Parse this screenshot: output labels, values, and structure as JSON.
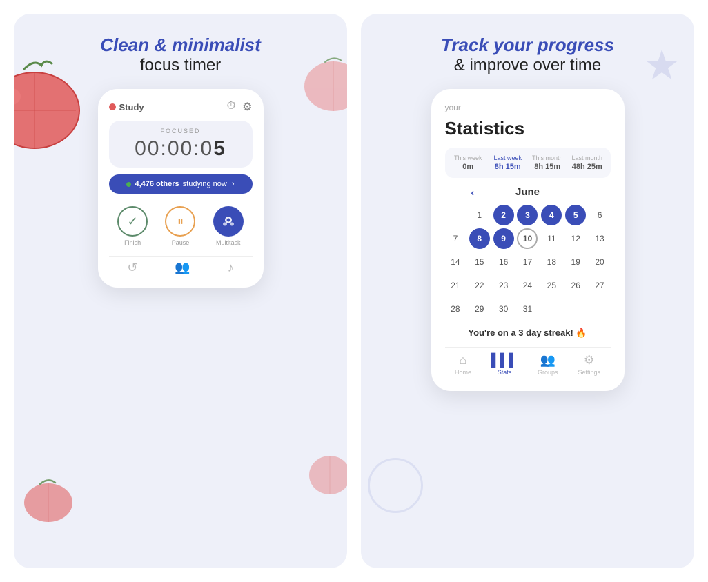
{
  "left": {
    "headline_italic": "Clean & minimalist",
    "headline_normal": "focus timer",
    "phone": {
      "study_label": "Study",
      "focused_label": "FOCUSED",
      "timer": "00:00:0",
      "timer_last": "5",
      "studying_text": "4,476 others studying now",
      "studying_arrow": ">",
      "actions": [
        {
          "label": "Finish",
          "icon": "✓",
          "type": "finish"
        },
        {
          "label": "Pause",
          "icon": "⏸",
          "type": "pause"
        },
        {
          "label": "Multitask",
          "icon": "👾",
          "type": "multitask"
        }
      ]
    }
  },
  "right": {
    "headline_italic": "Track your progress",
    "headline_normal": "& improve over time",
    "phone": {
      "stats_small": "your",
      "stats_title": "Statistics",
      "stats_cells": [
        {
          "header": "This week",
          "value": "0m",
          "active": false
        },
        {
          "header": "Last week",
          "value": "8h 15m",
          "active": true
        },
        {
          "header": "This month",
          "value": "8h 15m",
          "active": false
        },
        {
          "header": "Last month",
          "value": "48h 25m",
          "active": false
        }
      ],
      "calendar_month": "June",
      "calendar_days": [
        {
          "day": "",
          "type": "empty"
        },
        {
          "day": "1",
          "type": "normal"
        },
        {
          "day": "2",
          "type": "filled"
        },
        {
          "day": "3",
          "type": "filled"
        },
        {
          "day": "4",
          "type": "filled"
        },
        {
          "day": "5",
          "type": "filled"
        },
        {
          "day": "6",
          "type": "normal"
        },
        {
          "day": "7",
          "type": "normal"
        },
        {
          "day": "8",
          "type": "filled"
        },
        {
          "day": "9",
          "type": "filled"
        },
        {
          "day": "10",
          "type": "today"
        },
        {
          "day": "11",
          "type": "normal"
        },
        {
          "day": "12",
          "type": "normal"
        },
        {
          "day": "13",
          "type": "normal"
        },
        {
          "day": "14",
          "type": "normal"
        },
        {
          "day": "15",
          "type": "normal"
        },
        {
          "day": "16",
          "type": "normal"
        },
        {
          "day": "17",
          "type": "normal"
        },
        {
          "day": "18",
          "type": "normal"
        },
        {
          "day": "19",
          "type": "normal"
        },
        {
          "day": "20",
          "type": "normal"
        },
        {
          "day": "21",
          "type": "normal"
        },
        {
          "day": "22",
          "type": "normal"
        },
        {
          "day": "23",
          "type": "normal"
        },
        {
          "day": "24",
          "type": "normal"
        },
        {
          "day": "25",
          "type": "normal"
        },
        {
          "day": "26",
          "type": "normal"
        },
        {
          "day": "27",
          "type": "normal"
        },
        {
          "day": "28",
          "type": "normal"
        },
        {
          "day": "29",
          "type": "normal"
        },
        {
          "day": "30",
          "type": "normal"
        },
        {
          "day": "31",
          "type": "normal"
        }
      ],
      "streak_text": "You're on a 3 day streak! 🔥",
      "tabs": [
        {
          "label": "Home",
          "icon": "⌂",
          "active": false
        },
        {
          "label": "Stats",
          "icon": "📊",
          "active": true
        },
        {
          "label": "Groups",
          "icon": "👥",
          "active": false
        },
        {
          "label": "Settings",
          "icon": "⚙",
          "active": false
        }
      ]
    }
  }
}
